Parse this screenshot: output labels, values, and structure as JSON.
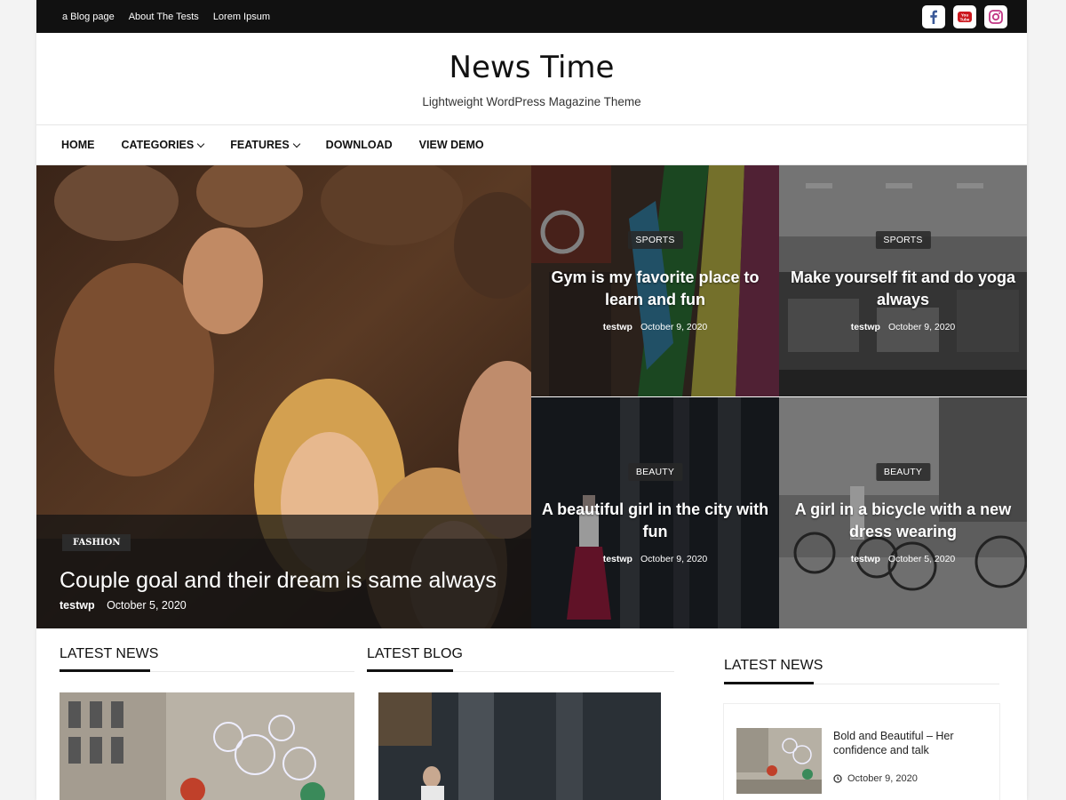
{
  "topbar": {
    "links": [
      "a Blog page",
      "About The Tests",
      "Lorem Ipsum"
    ],
    "social": [
      "facebook-icon",
      "youtube-icon",
      "instagram-icon"
    ]
  },
  "header": {
    "title": "News Time",
    "description": "Lightweight WordPress Magazine Theme"
  },
  "nav": {
    "items": [
      "HOME",
      "CATEGORIES",
      "FEATURES",
      "DOWNLOAD",
      "VIEW DEMO"
    ]
  },
  "featured": {
    "big": {
      "category": "FASHION",
      "title": "Couple goal and their dream is same always",
      "author": "testwp",
      "date": "October 5, 2020"
    },
    "small": [
      {
        "category": "SPORTS",
        "title": "Gym is my favorite place to learn and fun",
        "author": "testwp",
        "date": "October 9, 2020"
      },
      {
        "category": "SPORTS",
        "title": "Make yourself fit and do yoga always",
        "author": "testwp",
        "date": "October 9, 2020"
      },
      {
        "category": "BEAUTY",
        "title": "A beautiful girl in the city with fun",
        "author": "testwp",
        "date": "October 9, 2020"
      },
      {
        "category": "BEAUTY",
        "title": "A girl in a bicycle with a new dress wearing",
        "author": "testwp",
        "date": "October 5, 2020"
      }
    ]
  },
  "sections": {
    "latest_news": "LATEST NEWS",
    "latest_blog": "LATEST BLOG",
    "sidebar_latest_news": "LATEST NEWS"
  },
  "sidebar_post": {
    "title": "Bold and Beautiful – Her confidence and talk",
    "date": "October 9, 2020"
  },
  "colors": {
    "topbar": "#111111",
    "accent": "#111111"
  }
}
